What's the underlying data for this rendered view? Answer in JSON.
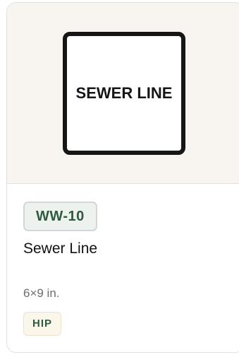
{
  "product": {
    "sign_text": "SEWER LINE",
    "code": "WW-10",
    "title": "Sewer Line",
    "size": "6×9 in.",
    "tag": "HIP"
  }
}
